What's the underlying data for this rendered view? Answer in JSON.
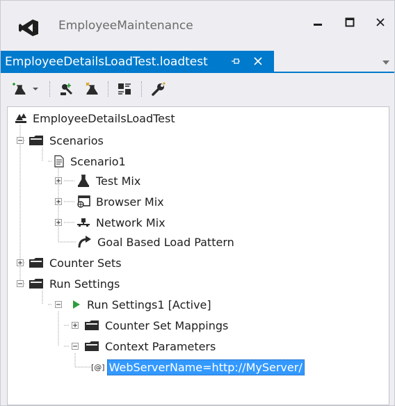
{
  "window": {
    "title": "EmployeeMaintenance"
  },
  "document_tab": {
    "label": "EmployeeDetailsLoadTest.loadtest",
    "pin_icon": "pin-icon",
    "close_icon": "close-icon"
  },
  "toolbar": {
    "buttons": [
      {
        "icon": "add-scenario-icon",
        "has_dropdown": true
      },
      {
        "icon": "add-counter-set-icon"
      },
      {
        "icon": "add-test-icon"
      },
      {
        "icon": "manage-counter-sets-icon"
      },
      {
        "icon": "properties-wrench-icon"
      }
    ]
  },
  "tree": {
    "root": "EmployeeDetailsLoadTest",
    "scenarios": "Scenarios",
    "scenario1": "Scenario1",
    "test_mix": "Test Mix",
    "browser_mix": "Browser Mix",
    "network_mix": "Network Mix",
    "load_pattern": "Goal Based Load Pattern",
    "counter_sets": "Counter Sets",
    "run_settings": "Run Settings",
    "run_settings1": "Run Settings1 [Active]",
    "counter_set_mappings": "Counter Set Mappings",
    "context_parameters": "Context Parameters",
    "context_param_tag": "[@]",
    "web_server_name": "WebServerName=http://MyServer/"
  },
  "colors": {
    "accent": "#007acc",
    "selection": "#3399ff",
    "play_green": "#2e9e3a",
    "folder_dark": "#2b2b2b"
  }
}
